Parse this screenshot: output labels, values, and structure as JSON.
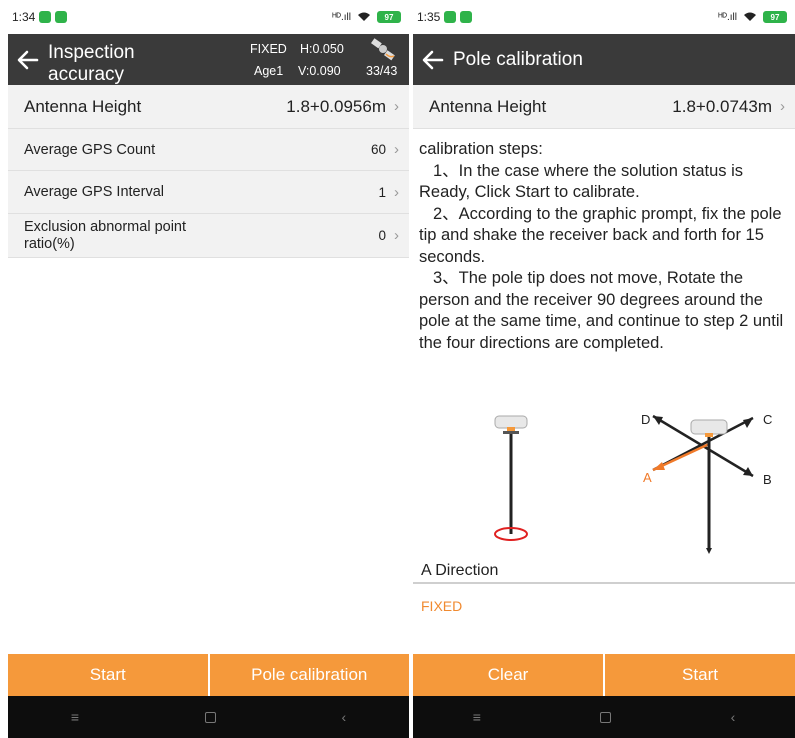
{
  "left": {
    "status": {
      "time": "1:34",
      "signal": "ᴴᴰ.ıll",
      "battery": "97"
    },
    "title": "Inspection accuracy",
    "solution": {
      "status": "FIXED",
      "h": "H:0.050",
      "age": "Age1",
      "v": "V:0.090",
      "sats": "33/43"
    },
    "rows": [
      {
        "label": "Antenna Height",
        "value": "1.8+0.0956m"
      },
      {
        "label": "Average GPS Count",
        "value": "60"
      },
      {
        "label": "Average GPS Interval",
        "value": "1"
      },
      {
        "label": "Exclusion abnormal point ratio(%)",
        "value": "0"
      }
    ],
    "buttons": {
      "start": "Start",
      "pole_calibration": "Pole calibration"
    }
  },
  "right": {
    "status": {
      "time": "1:35",
      "signal": "ᴴᴰ.ıll",
      "battery": "97"
    },
    "title": "Pole calibration",
    "antenna": {
      "label": "Antenna Height",
      "value": "1.8+0.0743m"
    },
    "steps": {
      "heading": "calibration steps:",
      "step1": "1、In the case where the solution status is Ready, Click Start to calibrate.",
      "step2": "2、According to the graphic prompt, fix the pole tip and shake the receiver back and forth for 15 seconds.",
      "step3": "3、The pole tip does not move, Rotate the person and the receiver 90 degrees around the pole at the same time, and continue to step 2 until the four directions are completed."
    },
    "diagram": {
      "a": "A",
      "b": "B",
      "c": "C",
      "d": "D"
    },
    "direction": "A Direction",
    "fix_status": "FIXED",
    "buttons": {
      "clear": "Clear",
      "start": "Start"
    }
  },
  "colors": {
    "accent": "#f5993b",
    "titlebar": "#3a3a3a",
    "fixed": "#f08a30",
    "arrow_a": "#f07a2a"
  },
  "icons": {
    "back": "back-arrow-icon",
    "satellite": "satellite-icon",
    "chevron": "chevron-right-icon",
    "menu": "menu-icon",
    "home": "home-icon",
    "navback": "nav-back-icon"
  }
}
